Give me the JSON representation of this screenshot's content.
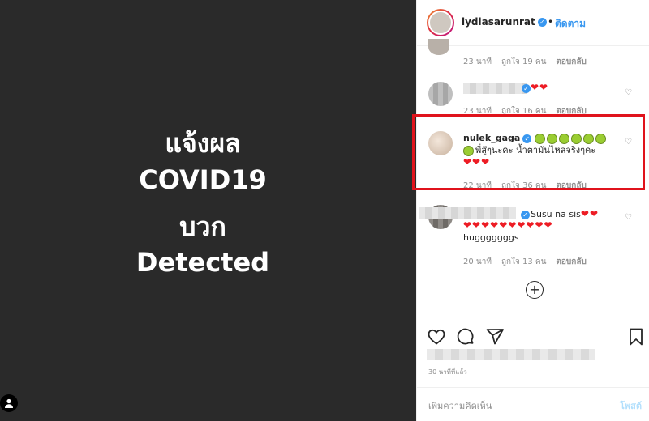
{
  "post": {
    "lines": [
      "แจ้งผล",
      "COVID19",
      "บวก",
      "Detected"
    ],
    "background": "#2a2a2a"
  },
  "header": {
    "username": "lydiasarunrat",
    "separator": "•",
    "follow_label": "ติดตาม"
  },
  "comments": [
    {
      "time": "23 นาที",
      "likes": "ถูกใจ 19 คน",
      "reply": "ตอบกลับ"
    },
    {
      "hearts": "❤❤",
      "time": "23 นาที",
      "likes": "ถูกใจ 16 คน",
      "reply": "ตอบกลับ"
    },
    {
      "username": "nulek_gaga",
      "text": "พี่สู้ๆนะคะ น้ำตามันไหลจริงๆคะ",
      "hearts": "❤❤❤",
      "time": "22 นาที",
      "likes": "ถูกใจ 36 คน",
      "reply": "ตอบกลับ"
    },
    {
      "text": "Susu na sis",
      "hearts_inline": "❤❤",
      "hearts_row": "❤❤❤❤❤❤❤❤❤❤",
      "text2": "hugggggggs",
      "time": "20 นาที",
      "likes": "ถูกใจ 13 คน",
      "reply": "ตอบกลับ"
    }
  ],
  "actions": {
    "time_ago": "30 นาทีที่แล้ว"
  },
  "add_comment": {
    "placeholder": "เพิ่มความคิดเห็น",
    "post_label": "โพสต์"
  },
  "colors": {
    "accent": "#3897f0",
    "highlight": "#e0131c",
    "heart": "#ed1c24"
  }
}
